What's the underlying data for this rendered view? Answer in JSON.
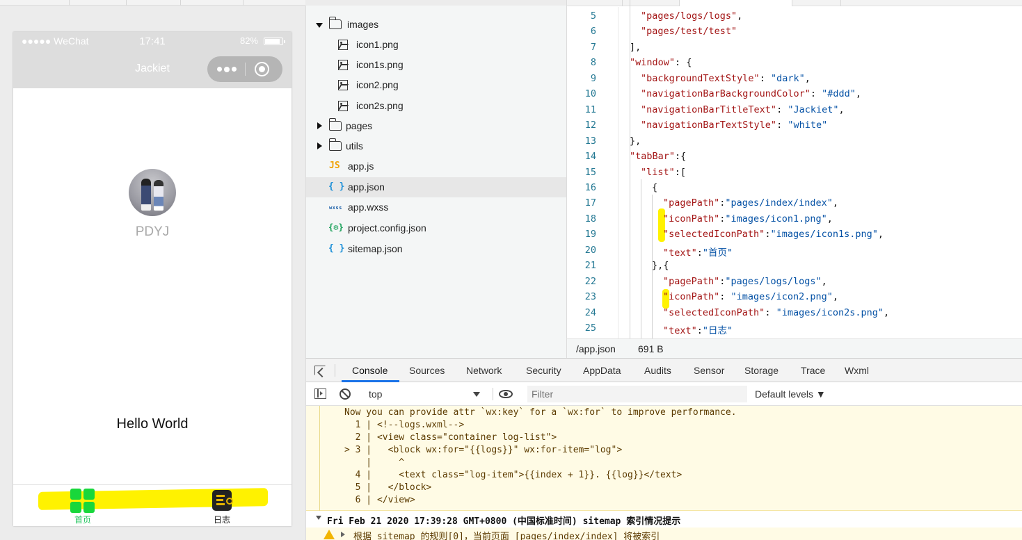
{
  "simulator": {
    "status_bar": {
      "carrier": "●●●●● WeChat",
      "time": "17:41",
      "battery": "82%"
    },
    "nav_title": "Jackiet",
    "nickname": "PDYJ",
    "content_text": "Hello World",
    "tabs": [
      {
        "label": "首页",
        "icon": "grid-icon",
        "selected": true,
        "color": "#22c55e"
      },
      {
        "label": "日志",
        "icon": "log-icon",
        "selected": false,
        "color": "#222222"
      }
    ]
  },
  "file_tree": [
    {
      "name": "images",
      "type": "folder",
      "expanded": true,
      "indent": 0
    },
    {
      "name": "icon1.png",
      "type": "image",
      "indent": 1
    },
    {
      "name": "icon1s.png",
      "type": "image",
      "indent": 1
    },
    {
      "name": "icon2.png",
      "type": "image",
      "indent": 1
    },
    {
      "name": "icon2s.png",
      "type": "image",
      "indent": 1
    },
    {
      "name": "pages",
      "type": "folder",
      "expanded": false,
      "indent": 0
    },
    {
      "name": "utils",
      "type": "folder",
      "expanded": false,
      "indent": 0
    },
    {
      "name": "app.js",
      "type": "js",
      "indent": 0
    },
    {
      "name": "app.json",
      "type": "json",
      "indent": 0,
      "selected": true
    },
    {
      "name": "app.wxss",
      "type": "wxss",
      "indent": 0
    },
    {
      "name": "project.config.json",
      "type": "config",
      "indent": 0
    },
    {
      "name": "sitemap.json",
      "type": "json",
      "indent": 0
    }
  ],
  "file_icons": {
    "js": "JS",
    "json": "{ }",
    "wxss": "wxss",
    "config": "{⚙}"
  },
  "editor": {
    "lines": [
      {
        "n": "5",
        "indent": 2,
        "parts": [
          [
            "s",
            "\"pages/logs/logs\""
          ],
          [
            "p",
            ","
          ]
        ]
      },
      {
        "n": "6",
        "indent": 2,
        "parts": [
          [
            "s",
            "\"pages/test/test\""
          ]
        ]
      },
      {
        "n": "7",
        "indent": 1,
        "parts": [
          [
            "p",
            "],"
          ]
        ]
      },
      {
        "n": "8",
        "indent": 1,
        "parts": [
          [
            "s",
            "\"window\""
          ],
          [
            "p",
            ": {"
          ]
        ]
      },
      {
        "n": "9",
        "indent": 2,
        "parts": [
          [
            "s",
            "\"backgroundTextStyle\""
          ],
          [
            "p",
            ": "
          ],
          [
            "v",
            "\"dark\""
          ],
          [
            "p",
            ","
          ]
        ]
      },
      {
        "n": "10",
        "indent": 2,
        "parts": [
          [
            "s",
            "\"navigationBarBackgroundColor\""
          ],
          [
            "p",
            ": "
          ],
          [
            "v",
            "\"#ddd\""
          ],
          [
            "p",
            ","
          ]
        ]
      },
      {
        "n": "11",
        "indent": 2,
        "parts": [
          [
            "s",
            "\"navigationBarTitleText\""
          ],
          [
            "p",
            ": "
          ],
          [
            "v",
            "\"Jackiet\""
          ],
          [
            "p",
            ","
          ]
        ]
      },
      {
        "n": "12",
        "indent": 2,
        "parts": [
          [
            "s",
            "\"navigationBarTextStyle\""
          ],
          [
            "p",
            ": "
          ],
          [
            "v",
            "\"white\""
          ]
        ]
      },
      {
        "n": "13",
        "indent": 1,
        "parts": [
          [
            "p",
            "},"
          ]
        ]
      },
      {
        "n": "14",
        "indent": 1,
        "parts": [
          [
            "s",
            "\"tabBar\""
          ],
          [
            "p",
            ":{"
          ]
        ]
      },
      {
        "n": "15",
        "indent": 2,
        "parts": [
          [
            "s",
            "\"list\""
          ],
          [
            "p",
            ":["
          ]
        ]
      },
      {
        "n": "16",
        "indent": 3,
        "parts": [
          [
            "p",
            "{"
          ]
        ]
      },
      {
        "n": "17",
        "indent": 4,
        "parts": [
          [
            "s",
            "\"pagePath\""
          ],
          [
            "p",
            ":"
          ],
          [
            "v",
            "\"pages/index/index\""
          ],
          [
            "p",
            ","
          ]
        ]
      },
      {
        "n": "18",
        "indent": 4,
        "parts": [
          [
            "s",
            "\"iconPath\""
          ],
          [
            "p",
            ":"
          ],
          [
            "v",
            "\"images/icon1.png\""
          ],
          [
            "p",
            ","
          ]
        ]
      },
      {
        "n": "19",
        "indent": 4,
        "parts": [
          [
            "s",
            "\"selectedIconPath\""
          ],
          [
            "p",
            ":"
          ],
          [
            "v",
            "\"images/icon1s.png\""
          ],
          [
            "p",
            ","
          ]
        ]
      },
      {
        "n": "20",
        "indent": 4,
        "parts": [
          [
            "s",
            "\"text\""
          ],
          [
            "p",
            ":"
          ],
          [
            "v",
            "\"首页\""
          ]
        ]
      },
      {
        "n": "21",
        "indent": 3,
        "parts": [
          [
            "p",
            "},{"
          ]
        ]
      },
      {
        "n": "22",
        "indent": 4,
        "parts": [
          [
            "s",
            "\"pagePath\""
          ],
          [
            "p",
            ":"
          ],
          [
            "v",
            "\"pages/logs/logs\""
          ],
          [
            "p",
            ","
          ]
        ]
      },
      {
        "n": "23",
        "indent": 4,
        "parts": [
          [
            "s",
            "\"iconPath\""
          ],
          [
            "p",
            ": "
          ],
          [
            "v",
            "\"images/icon2.png\""
          ],
          [
            "p",
            ","
          ]
        ]
      },
      {
        "n": "24",
        "indent": 4,
        "parts": [
          [
            "s",
            "\"selectedIconPath\""
          ],
          [
            "p",
            ": "
          ],
          [
            "v",
            "\"images/icon2s.png\""
          ],
          [
            "p",
            ","
          ]
        ]
      },
      {
        "n": "25",
        "indent": 4,
        "parts": [
          [
            "s",
            "\"text\""
          ],
          [
            "p",
            ":"
          ],
          [
            "v",
            "\"日志\""
          ]
        ]
      }
    ],
    "status_path": "/app.json",
    "status_size": "691 B"
  },
  "devtools": {
    "tabs": [
      "Console",
      "Sources",
      "Network",
      "Security",
      "AppData",
      "Audits",
      "Sensor",
      "Storage",
      "Trace",
      "Wxml"
    ],
    "active_tab": "Console",
    "context": "top",
    "filter_placeholder": "Filter",
    "levels": "Default levels ▼",
    "warning_lines": [
      "Now you can provide attr `wx:key` for a `wx:for` to improve performance.",
      "  1 | <!--logs.wxml-->",
      "  2 | <view class=\"container log-list\">",
      "> 3 |   <block wx:for=\"{{logs}}\" wx:for-item=\"log\">",
      "    |     ^",
      "  4 |     <text class=\"log-item\">{{index + 1}}. {{log}}</text>",
      "  5 |   </block>",
      "  6 | </view>"
    ],
    "info_line": "Fri Feb 21 2020 17:39:28 GMT+0800 (中国标准时间) sitemap 索引情况提示",
    "warn_line": "根据 sitemap 的规则[0]，当前页面 [pages/index/index] 将被索引",
    "colors": {
      "accent": "#1a73e8",
      "warning_bg": "#fffbe5"
    }
  }
}
